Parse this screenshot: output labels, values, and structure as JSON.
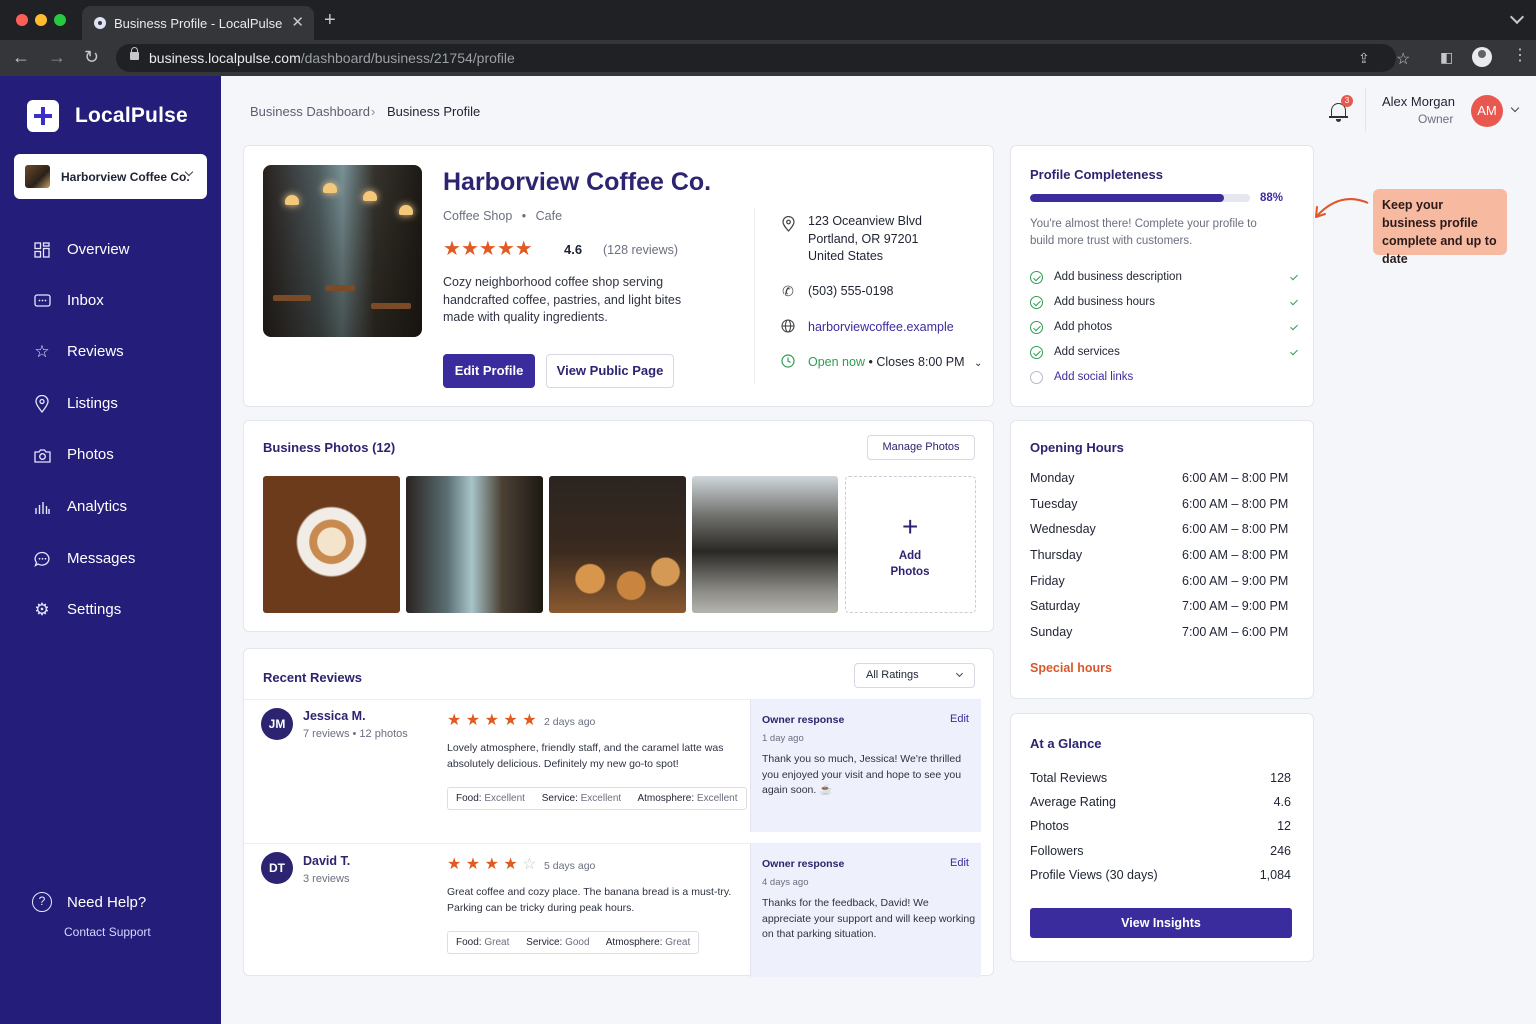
{
  "browser": {
    "tab_title": "Business Profile - LocalPulse",
    "url_host": "business.localpulse.com",
    "url_path": "/dashboard/business/21754/profile"
  },
  "sidebar": {
    "app_name": "LocalPulse",
    "business_switcher": "Harborview Coffee Co.",
    "items": [
      {
        "label": "Overview",
        "icon": "grid-icon"
      },
      {
        "label": "Inbox",
        "icon": "inbox-icon"
      },
      {
        "label": "Reviews",
        "icon": "star-icon"
      },
      {
        "label": "Listings",
        "icon": "location-pin-icon"
      },
      {
        "label": "Photos",
        "icon": "camera-icon"
      },
      {
        "label": "Analytics",
        "icon": "bar-chart-icon"
      },
      {
        "label": "Messages",
        "icon": "chat-bubble-icon"
      },
      {
        "label": "Settings",
        "icon": "gear-icon"
      }
    ],
    "help_label": "Need Help?",
    "help_link": "Contact Support"
  },
  "header": {
    "breadcrumb": [
      "Business Dashboard",
      "Business Profile"
    ],
    "notification_count": "3",
    "user_name": "Alex Morgan",
    "user_role": "Owner",
    "user_initials": "AM"
  },
  "profile": {
    "name": "Harborview Coffee Co.",
    "category": "Coffee Shop",
    "subcategory": "Cafe",
    "rating": "4.6",
    "stars": 5,
    "review_count": "(128 reviews)",
    "description": "Cozy neighborhood coffee shop serving handcrafted coffee, pastries, and light bites made with quality ingredients.",
    "edit_label": "Edit Profile",
    "public_label": "View Public Page",
    "address_line1": "123 Oceanview Blvd",
    "address_line2": "Portland, OR 97201",
    "address_line3": "United States",
    "phone": "(503) 555-0198",
    "website": "harborviewcoffee.example",
    "open_status": "Open now",
    "closes": "Closes 8:00 PM"
  },
  "completeness": {
    "title": "Profile Completeness",
    "percent_label": "88%",
    "percent": 0.88,
    "subtitle": "You're almost there! Complete your profile to build more trust with customers.",
    "tasks": [
      {
        "label": "Add business description",
        "done": true
      },
      {
        "label": "Add business hours",
        "done": true
      },
      {
        "label": "Add photos",
        "done": true
      },
      {
        "label": "Add services",
        "done": true
      },
      {
        "label": "Add social links",
        "done": false
      }
    ]
  },
  "callout": {
    "text": "Keep your business profile complete and up to date"
  },
  "photos": {
    "title": "Business Photos (12)",
    "manage_label": "Manage Photos",
    "add_line1": "Add",
    "add_line2": "Photos"
  },
  "reviews": {
    "title": "Recent Reviews",
    "filter": "All Ratings",
    "items": [
      {
        "initials": "JM",
        "name": "Jessica M.",
        "meta": "7 reviews  •  12 photos",
        "stars": 5,
        "time": "2 days ago",
        "text": "Lovely atmosphere, friendly staff, and the caramel latte was absolutely delicious. Definitely my new go-to spot!",
        "food_label": "Food:",
        "food": "Excellent",
        "service_label": "Service:",
        "service": "Excellent",
        "atmosphere_label": "Atmosphere:",
        "atmosphere": "Excellent",
        "owner_title": "Owner response",
        "owner_edit": "Edit",
        "owner_time": "1 day ago",
        "owner_text": "Thank you so much, Jessica! We're thrilled you enjoyed your visit and hope to see you again soon. ☕"
      },
      {
        "initials": "DT",
        "name": "David T.",
        "meta": "3 reviews",
        "stars": 4,
        "time": "5 days ago",
        "text": "Great coffee and cozy place. The banana bread is a must-try. Parking can be tricky during peak hours.",
        "food_label": "Food:",
        "food": "Great",
        "service_label": "Service:",
        "service": "Good",
        "atmosphere_label": "Atmosphere:",
        "atmosphere": "Great",
        "owner_title": "Owner response",
        "owner_edit": "Edit",
        "owner_time": "4 days ago",
        "owner_text": "Thanks for the feedback, David! We appreciate your support and will keep working on that parking situation."
      }
    ]
  },
  "hours": {
    "title": "Opening Hours",
    "rows": [
      {
        "day": "Monday",
        "time": "6:00 AM – 8:00 PM"
      },
      {
        "day": "Tuesday",
        "time": "6:00 AM – 8:00 PM"
      },
      {
        "day": "Wednesday",
        "time": "6:00 AM – 8:00 PM"
      },
      {
        "day": "Thursday",
        "time": "6:00 AM – 8:00 PM"
      },
      {
        "day": "Friday",
        "time": "6:00 AM – 9:00 PM"
      },
      {
        "day": "Saturday",
        "time": "7:00 AM – 9:00 PM"
      },
      {
        "day": "Sunday",
        "time": "7:00 AM – 6:00 PM"
      }
    ],
    "special_label": "Special hours"
  },
  "glance": {
    "title": "At a Glance",
    "rows": [
      {
        "label": "Total Reviews",
        "value": "128"
      },
      {
        "label": "Average Rating",
        "value": "4.6"
      },
      {
        "label": "Photos",
        "value": "12"
      },
      {
        "label": "Followers",
        "value": "246"
      },
      {
        "label": "Profile Views (30 days)",
        "value": "1,084"
      }
    ],
    "button_label": "View Insights"
  },
  "colors": {
    "sidebar": "#241d7a",
    "primary": "#3b2c9e",
    "accent_orange": "#e05a22",
    "success": "#2e9d52",
    "callout": "#f8b9a1"
  }
}
